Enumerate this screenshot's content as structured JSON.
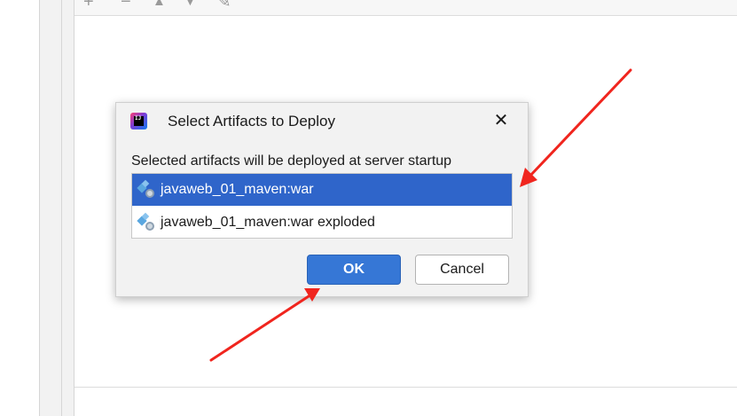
{
  "dialog": {
    "title": "Select Artifacts to Deploy",
    "close_glyph": "✕",
    "app_icon_text": "IJ",
    "description": "Selected artifacts will be deployed at server startup",
    "artifacts": [
      {
        "label": "javaweb_01_maven:war",
        "selected": true
      },
      {
        "label": "javaweb_01_maven:war exploded",
        "selected": false
      }
    ],
    "ok_label": "OK",
    "cancel_label": "Cancel"
  },
  "toolbar": {
    "icons": [
      "plus-icon",
      "minus-icon",
      "arrow-up-icon",
      "arrow-down-icon",
      "edit-icon"
    ],
    "glyphs": [
      "+",
      "−",
      "▲",
      "▼",
      "✎"
    ]
  },
  "colors": {
    "selection": "#2f65ca",
    "ok_button": "#3677d6",
    "annotation_arrow": "#f0251e"
  }
}
